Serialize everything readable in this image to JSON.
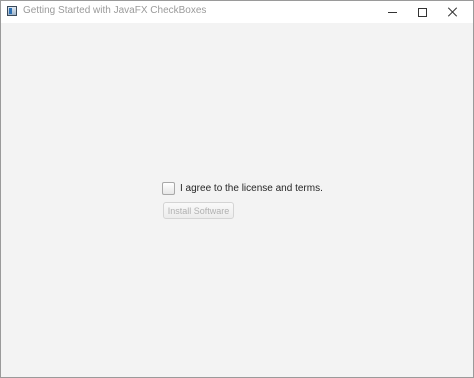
{
  "window": {
    "title": "Getting Started with JavaFX CheckBoxes",
    "icon": "java-app-icon",
    "controls": {
      "minimize_icon": "minimize-icon",
      "maximize_icon": "maximize-icon",
      "close_icon": "close-icon"
    }
  },
  "main": {
    "agree_checkbox": {
      "label": "I agree to the license and terms.",
      "checked": false
    },
    "install_button": {
      "label": "Install Software",
      "enabled": false
    }
  },
  "colors": {
    "background": "#f3f3f3",
    "title_text": "#9a9a9a",
    "label_text": "#262626",
    "disabled_text": "#b0b0b0"
  }
}
